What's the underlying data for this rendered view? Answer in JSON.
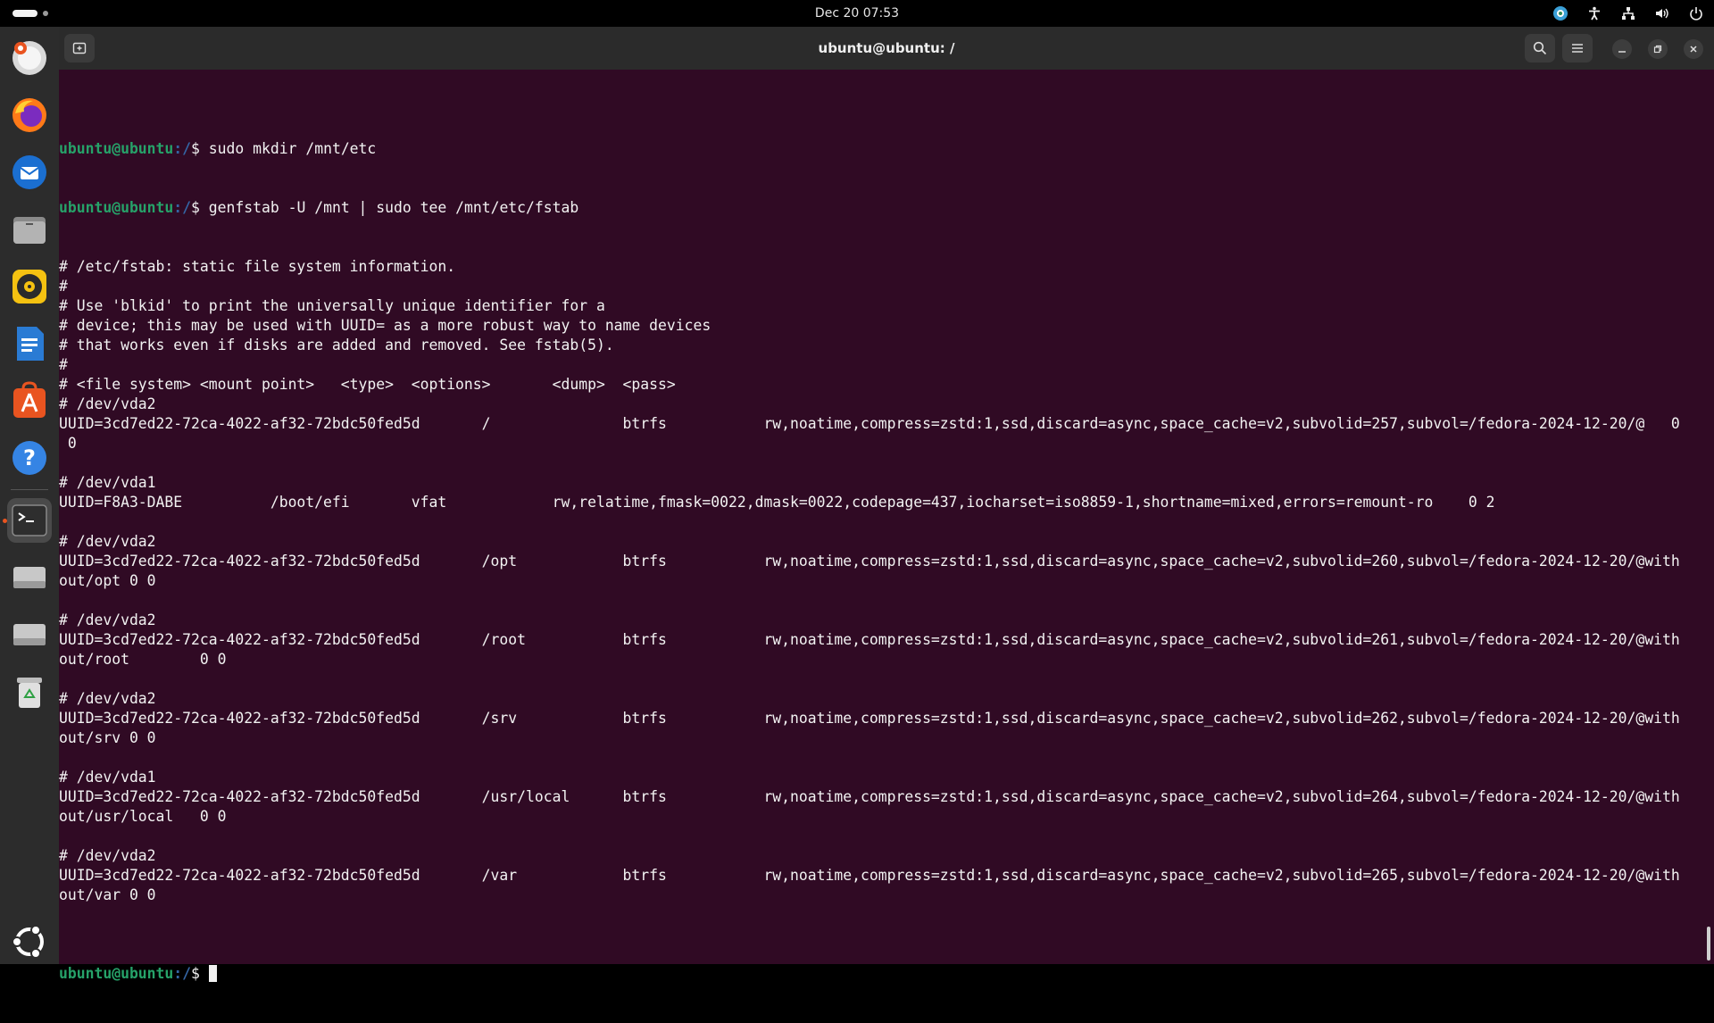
{
  "topbar": {
    "datetime": "Dec 20  07:53",
    "icons": [
      "activities-indicator",
      "copilot-icon",
      "accessibility-icon",
      "network-icon",
      "volume-icon",
      "power-icon"
    ]
  },
  "dock": {
    "items": [
      "help-logo-icon",
      "firefox-icon",
      "thunderbird-icon",
      "files-icon",
      "rhythmbox-icon",
      "libreoffice-writer-icon",
      "app-center-icon",
      "help-icon",
      "terminal-icon",
      "drive-icon",
      "drive-icon-2",
      "trash-icon",
      "ubuntu-logo-icon"
    ],
    "active": "terminal-icon"
  },
  "window": {
    "title": "ubuntu@ubuntu: /"
  },
  "terminal": {
    "prompt_user": "ubuntu@ubuntu",
    "prompt_path": ":/",
    "prompt_sep": "$ ",
    "cmd1": "sudo mkdir /mnt/etc",
    "cmd2": "genfstab -U /mnt | sudo tee /mnt/etc/fstab",
    "output": [
      "# /etc/fstab: static file system information.",
      "#",
      "# Use 'blkid' to print the universally unique identifier for a",
      "# device; this may be used with UUID= as a more robust way to name devices",
      "# that works even if disks are added and removed. See fstab(5).",
      "#",
      "# <file system> <mount point>   <type>  <options>       <dump>  <pass>",
      "# /dev/vda2",
      "UUID=3cd7ed22-72ca-4022-af32-72bdc50fed5d       /               btrfs           rw,noatime,compress=zstd:1,ssd,discard=async,space_cache=v2,subvolid=257,subvol=/fedora-2024-12-20/@   0",
      " 0",
      "",
      "# /dev/vda1",
      "UUID=F8A3-DABE          /boot/efi       vfat            rw,relatime,fmask=0022,dmask=0022,codepage=437,iocharset=iso8859-1,shortname=mixed,errors=remount-ro    0 2",
      "",
      "# /dev/vda2",
      "UUID=3cd7ed22-72ca-4022-af32-72bdc50fed5d       /opt            btrfs           rw,noatime,compress=zstd:1,ssd,discard=async,space_cache=v2,subvolid=260,subvol=/fedora-2024-12-20/@with",
      "out/opt 0 0",
      "",
      "# /dev/vda2",
      "UUID=3cd7ed22-72ca-4022-af32-72bdc50fed5d       /root           btrfs           rw,noatime,compress=zstd:1,ssd,discard=async,space_cache=v2,subvolid=261,subvol=/fedora-2024-12-20/@with",
      "out/root        0 0",
      "",
      "# /dev/vda2",
      "UUID=3cd7ed22-72ca-4022-af32-72bdc50fed5d       /srv            btrfs           rw,noatime,compress=zstd:1,ssd,discard=async,space_cache=v2,subvolid=262,subvol=/fedora-2024-12-20/@with",
      "out/srv 0 0",
      "",
      "# /dev/vda1",
      "UUID=3cd7ed22-72ca-4022-af32-72bdc50fed5d       /usr/local      btrfs           rw,noatime,compress=zstd:1,ssd,discard=async,space_cache=v2,subvolid=264,subvol=/fedora-2024-12-20/@with",
      "out/usr/local   0 0",
      "",
      "# /dev/vda2",
      "UUID=3cd7ed22-72ca-4022-af32-72bdc50fed5d       /var            btrfs           rw,noatime,compress=zstd:1,ssd,discard=async,space_cache=v2,subvolid=265,subvol=/fedora-2024-12-20/@with",
      "out/var 0 0",
      ""
    ]
  },
  "colors": {
    "terminal_bg": "#300a24",
    "prompt_user": "#26a269",
    "prompt_path": "#3465a4",
    "topbar_bg": "#000000",
    "dock_bg": "#2c2c2c"
  }
}
